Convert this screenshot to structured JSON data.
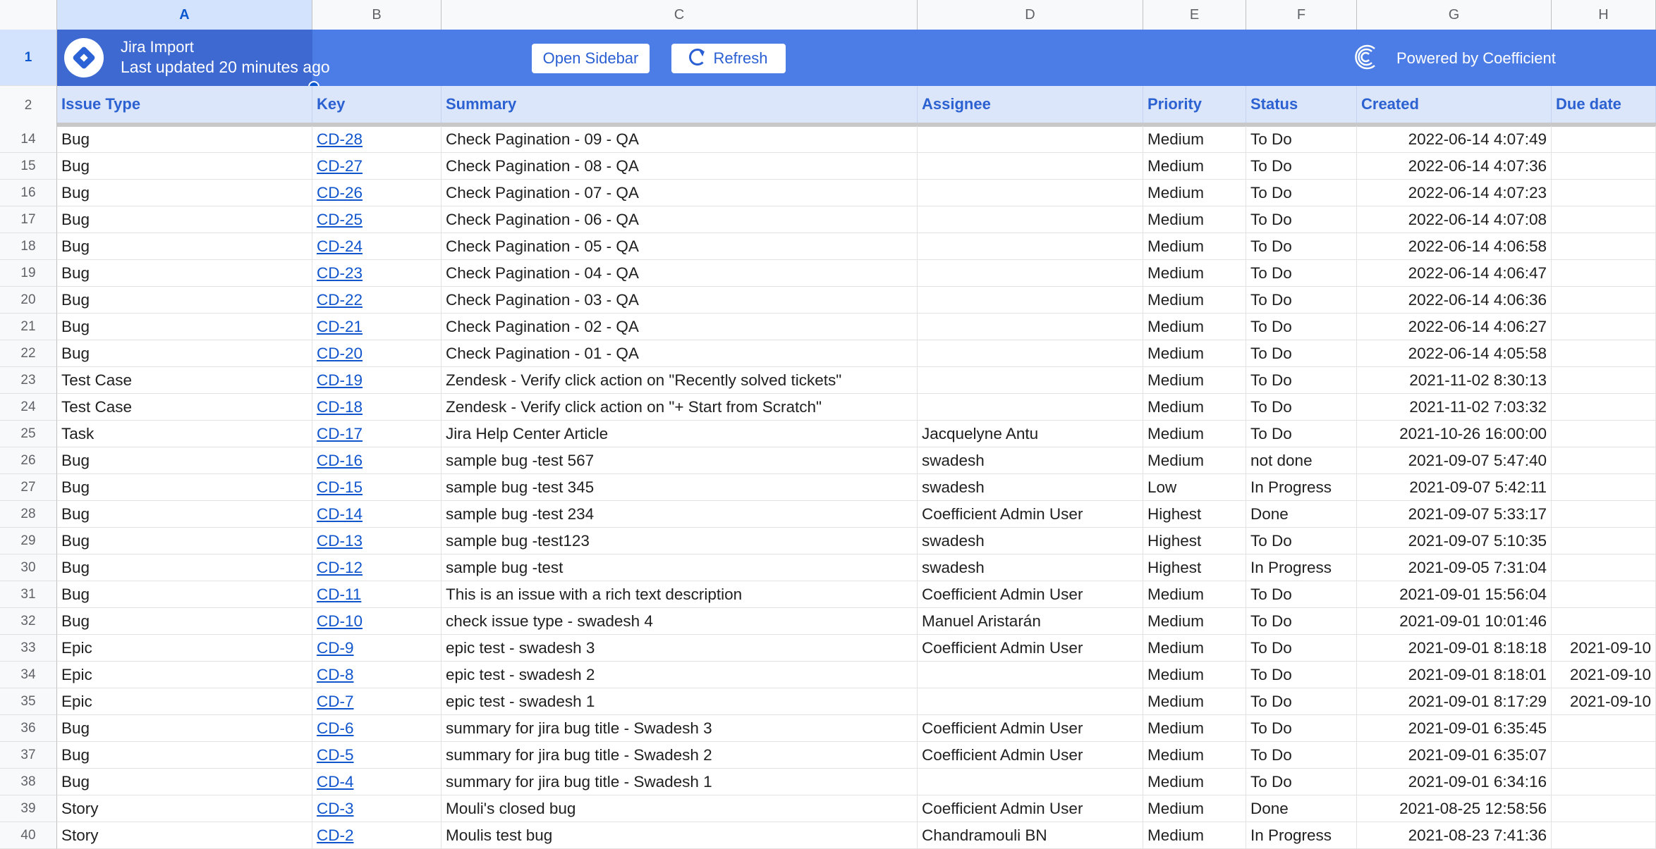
{
  "columns": [
    "A",
    "B",
    "C",
    "D",
    "E",
    "F",
    "G",
    "H"
  ],
  "row_numbers": [
    "1",
    "2"
  ],
  "banner": {
    "title": "Jira Import",
    "subtitle": "Last updated 20 minutes ago",
    "open_sidebar": "Open Sidebar",
    "refresh": "Refresh",
    "powered_by": "Powered by Coefficient"
  },
  "headers": [
    "Issue Type",
    "Key",
    "Summary",
    "Assignee",
    "Priority",
    "Status",
    "Created",
    "Due date"
  ],
  "rows": [
    {
      "n": "14",
      "type": "Bug",
      "key": "CD-28",
      "summary": "Check Pagination - 09 - QA",
      "assignee": "",
      "priority": "Medium",
      "status": "To Do",
      "created": "2022-06-14 4:07:49",
      "due": ""
    },
    {
      "n": "15",
      "type": "Bug",
      "key": "CD-27",
      "summary": "Check Pagination - 08 - QA",
      "assignee": "",
      "priority": "Medium",
      "status": "To Do",
      "created": "2022-06-14 4:07:36",
      "due": ""
    },
    {
      "n": "16",
      "type": "Bug",
      "key": "CD-26",
      "summary": "Check Pagination - 07 - QA",
      "assignee": "",
      "priority": "Medium",
      "status": "To Do",
      "created": "2022-06-14 4:07:23",
      "due": ""
    },
    {
      "n": "17",
      "type": "Bug",
      "key": "CD-25",
      "summary": "Check Pagination - 06 - QA",
      "assignee": "",
      "priority": "Medium",
      "status": "To Do",
      "created": "2022-06-14 4:07:08",
      "due": ""
    },
    {
      "n": "18",
      "type": "Bug",
      "key": "CD-24",
      "summary": "Check Pagination - 05 - QA",
      "assignee": "",
      "priority": "Medium",
      "status": "To Do",
      "created": "2022-06-14 4:06:58",
      "due": ""
    },
    {
      "n": "19",
      "type": "Bug",
      "key": "CD-23",
      "summary": "Check Pagination - 04 - QA",
      "assignee": "",
      "priority": "Medium",
      "status": "To Do",
      "created": "2022-06-14 4:06:47",
      "due": ""
    },
    {
      "n": "20",
      "type": "Bug",
      "key": "CD-22",
      "summary": "Check Pagination - 03 - QA",
      "assignee": "",
      "priority": "Medium",
      "status": "To Do",
      "created": "2022-06-14 4:06:36",
      "due": ""
    },
    {
      "n": "21",
      "type": "Bug",
      "key": "CD-21",
      "summary": "Check Pagination - 02 - QA",
      "assignee": "",
      "priority": "Medium",
      "status": "To Do",
      "created": "2022-06-14 4:06:27",
      "due": ""
    },
    {
      "n": "22",
      "type": "Bug",
      "key": "CD-20",
      "summary": "Check Pagination - 01 - QA",
      "assignee": "",
      "priority": "Medium",
      "status": "To Do",
      "created": "2022-06-14 4:05:58",
      "due": ""
    },
    {
      "n": "23",
      "type": "Test Case",
      "key": "CD-19",
      "summary": "Zendesk - Verify click action on \"Recently solved tickets\"",
      "assignee": "",
      "priority": "Medium",
      "status": "To Do",
      "created": "2021-11-02 8:30:13",
      "due": ""
    },
    {
      "n": "24",
      "type": "Test Case",
      "key": "CD-18",
      "summary": "Zendesk - Verify click action on \"+ Start from Scratch\"",
      "assignee": "",
      "priority": "Medium",
      "status": "To Do",
      "created": "2021-11-02 7:03:32",
      "due": ""
    },
    {
      "n": "25",
      "type": "Task",
      "key": "CD-17",
      "summary": "Jira Help Center Article",
      "assignee": "Jacquelyne Antu",
      "priority": "Medium",
      "status": "To Do",
      "created": "2021-10-26 16:00:00",
      "due": ""
    },
    {
      "n": "26",
      "type": "Bug",
      "key": "CD-16",
      "summary": "sample bug -test 567",
      "assignee": "swadesh",
      "priority": "Medium",
      "status": "not done",
      "created": "2021-09-07 5:47:40",
      "due": ""
    },
    {
      "n": "27",
      "type": "Bug",
      "key": "CD-15",
      "summary": "sample bug -test 345",
      "assignee": "swadesh",
      "priority": "Low",
      "status": "In Progress",
      "created": "2021-09-07 5:42:11",
      "due": ""
    },
    {
      "n": "28",
      "type": "Bug",
      "key": "CD-14",
      "summary": "sample bug -test 234",
      "assignee": "Coefficient Admin User",
      "priority": "Highest",
      "status": "Done",
      "created": "2021-09-07 5:33:17",
      "due": ""
    },
    {
      "n": "29",
      "type": "Bug",
      "key": "CD-13",
      "summary": "sample bug -test123",
      "assignee": "swadesh",
      "priority": "Highest",
      "status": "To Do",
      "created": "2021-09-07 5:10:35",
      "due": ""
    },
    {
      "n": "30",
      "type": "Bug",
      "key": "CD-12",
      "summary": "sample bug -test",
      "assignee": "swadesh",
      "priority": "Highest",
      "status": "In Progress",
      "created": "2021-09-05 7:31:04",
      "due": ""
    },
    {
      "n": "31",
      "type": "Bug",
      "key": "CD-11",
      "summary": "This is an issue with a rich text description",
      "assignee": "Coefficient Admin User",
      "priority": "Medium",
      "status": "To Do",
      "created": "2021-09-01 15:56:04",
      "due": ""
    },
    {
      "n": "32",
      "type": "Bug",
      "key": "CD-10",
      "summary": "check issue type - swadesh 4",
      "assignee": "Manuel Aristarán",
      "priority": "Medium",
      "status": "To Do",
      "created": "2021-09-01 10:01:46",
      "due": ""
    },
    {
      "n": "33",
      "type": "Epic",
      "key": "CD-9",
      "summary": "epic test - swadesh 3",
      "assignee": "Coefficient Admin User",
      "priority": "Medium",
      "status": "To Do",
      "created": "2021-09-01 8:18:18",
      "due": "2021-09-10"
    },
    {
      "n": "34",
      "type": "Epic",
      "key": "CD-8",
      "summary": "epic test - swadesh 2",
      "assignee": "",
      "priority": "Medium",
      "status": "To Do",
      "created": "2021-09-01 8:18:01",
      "due": "2021-09-10"
    },
    {
      "n": "35",
      "type": "Epic",
      "key": "CD-7",
      "summary": "epic test - swadesh 1",
      "assignee": "",
      "priority": "Medium",
      "status": "To Do",
      "created": "2021-09-01 8:17:29",
      "due": "2021-09-10"
    },
    {
      "n": "36",
      "type": "Bug",
      "key": "CD-6",
      "summary": "summary for jira bug title - Swadesh 3",
      "assignee": "Coefficient Admin User",
      "priority": "Medium",
      "status": "To Do",
      "created": "2021-09-01 6:35:45",
      "due": ""
    },
    {
      "n": "37",
      "type": "Bug",
      "key": "CD-5",
      "summary": "summary for jira bug title - Swadesh 2",
      "assignee": "Coefficient Admin User",
      "priority": "Medium",
      "status": "To Do",
      "created": "2021-09-01 6:35:07",
      "due": ""
    },
    {
      "n": "38",
      "type": "Bug",
      "key": "CD-4",
      "summary": "summary for jira bug title - Swadesh 1",
      "assignee": "",
      "priority": "Medium",
      "status": "To Do",
      "created": "2021-09-01 6:34:16",
      "due": ""
    },
    {
      "n": "39",
      "type": "Story",
      "key": "CD-3",
      "summary": "Mouli's closed bug",
      "assignee": "Coefficient Admin User",
      "priority": "Medium",
      "status": "Done",
      "created": "2021-08-25 12:58:56",
      "due": ""
    },
    {
      "n": "40",
      "type": "Story",
      "key": "CD-2",
      "summary": "Moulis test bug",
      "assignee": "Chandramouli BN",
      "priority": "Medium",
      "status": "In Progress",
      "created": "2021-08-23 7:41:36",
      "due": ""
    }
  ],
  "colors": {
    "banner": "#4c7ce5",
    "header_bg": "#dce6fb",
    "header_text": "#2b61d1",
    "link": "#1155cc"
  }
}
